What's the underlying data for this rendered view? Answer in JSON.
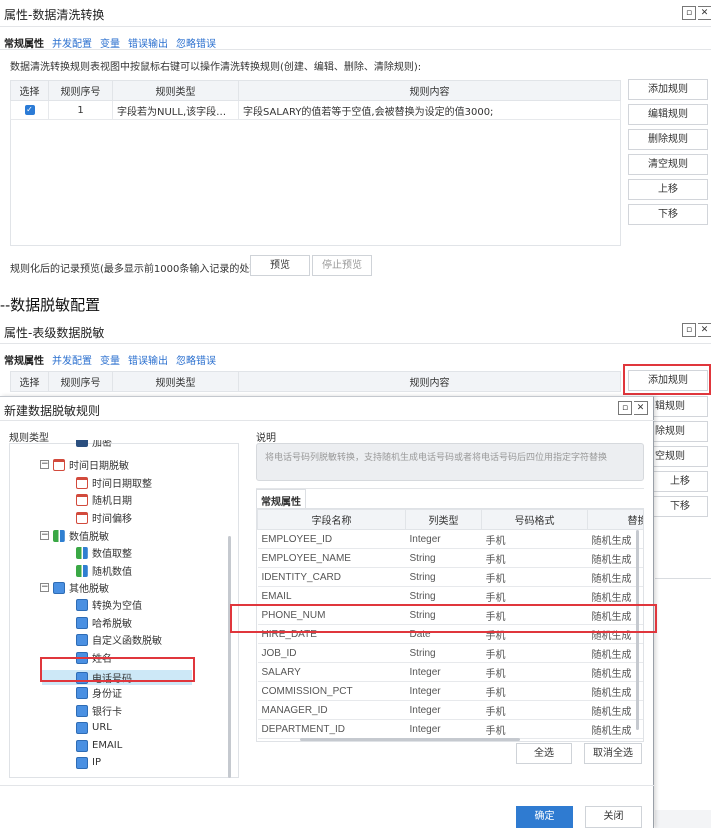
{
  "panel1": {
    "title": "属性-数据清洗转换",
    "tabs": [
      "常规属性",
      "并发配置",
      "变量",
      "错误输出",
      "忽略错误"
    ],
    "hint": "数据清洗转换规则表视图中按鼠标右键可以操作清洗转换规则(创建、编辑、删除、清除规则):",
    "table_headers": [
      "选择",
      "规则序号",
      "规则类型",
      "规则内容"
    ],
    "rows": [
      {
        "checked": true,
        "index": "1",
        "type": "字段若为NULL,该字段被...",
        "content": "字段SALARY的值若等于空值,会被替换为设定的值3000;"
      }
    ],
    "side_buttons": [
      "添加规则",
      "编辑规则",
      "删除规则",
      "清空规则",
      "上移",
      "下移"
    ],
    "preview_label": "规则化后的记录预览(最多显示前1000条输入记录的处理结果):",
    "preview_btn": "预览",
    "stop_preview_btn": "停止预览"
  },
  "caption": "--数据脱敏配置",
  "panel2": {
    "title": "属性-表级数据脱敏",
    "tabs": [
      "常规属性",
      "并发配置",
      "变量",
      "错误输出",
      "忽略错误"
    ],
    "table_headers": [
      "选择",
      "规则序号",
      "规则类型",
      "规则内容"
    ],
    "side_buttons": [
      "添加规则",
      "辑规则",
      "除规则",
      "空规则",
      "上移",
      "下移"
    ]
  },
  "dialog": {
    "title": "新建数据脱敏规则",
    "left_label": "规则类型",
    "desc_label": "说明",
    "desc_text": "将电话号码列脱敏转换，支持随机生成电话号码或者将电话号码后四位用指定字符替换",
    "tab": "常规属性",
    "tree": [
      {
        "level": 2,
        "icon": "misc",
        "label": "加密"
      },
      {
        "level": 1,
        "icon": "cal",
        "label": "时间日期脱敏",
        "toggle": "−"
      },
      {
        "level": 2,
        "icon": "cal",
        "label": "时间日期取整"
      },
      {
        "level": 2,
        "icon": "cal",
        "label": "随机日期"
      },
      {
        "level": 2,
        "icon": "cal",
        "label": "时间偏移"
      },
      {
        "level": 1,
        "icon": "num",
        "label": "数值脱敏",
        "toggle": "−"
      },
      {
        "level": 2,
        "icon": "num",
        "label": "数值取整"
      },
      {
        "level": 2,
        "icon": "num",
        "label": "随机数值"
      },
      {
        "level": 1,
        "icon": "oth",
        "label": "其他脱敏",
        "toggle": "−"
      },
      {
        "level": 2,
        "icon": "oth",
        "label": "转换为空值"
      },
      {
        "level": 2,
        "icon": "oth",
        "label": "哈希脱敏"
      },
      {
        "level": 2,
        "icon": "oth",
        "label": "自定义函数脱敏"
      },
      {
        "level": 2,
        "icon": "oth",
        "label": "姓名"
      },
      {
        "level": 2,
        "icon": "oth",
        "label": "电话号码",
        "selected": true
      },
      {
        "level": 2,
        "icon": "oth",
        "label": "身份证"
      },
      {
        "level": 2,
        "icon": "oth",
        "label": "银行卡"
      },
      {
        "level": 2,
        "icon": "oth",
        "label": "URL"
      },
      {
        "level": 2,
        "icon": "oth",
        "label": "EMAIL"
      },
      {
        "level": 2,
        "icon": "oth",
        "label": "IP"
      }
    ],
    "field_headers": [
      "字段名称",
      "列类型",
      "号码格式",
      "替换方"
    ],
    "fields": [
      [
        "EMPLOYEE_ID",
        "Integer",
        "手机",
        "随机生成"
      ],
      [
        "EMPLOYEE_NAME",
        "String",
        "手机",
        "随机生成"
      ],
      [
        "IDENTITY_CARD",
        "String",
        "手机",
        "随机生成"
      ],
      [
        "EMAIL",
        "String",
        "手机",
        "随机生成"
      ],
      [
        "PHONE_NUM",
        "String",
        "手机",
        "随机生成"
      ],
      [
        "HIRE_DATE",
        "Date",
        "手机",
        "随机生成"
      ],
      [
        "JOB_ID",
        "String",
        "手机",
        "随机生成"
      ],
      [
        "SALARY",
        "Integer",
        "手机",
        "随机生成"
      ],
      [
        "COMMISSION_PCT",
        "Integer",
        "手机",
        "随机生成"
      ],
      [
        "MANAGER_ID",
        "Integer",
        "手机",
        "随机生成"
      ],
      [
        "DEPARTMENT_ID",
        "Integer",
        "手机",
        "随机生成"
      ]
    ],
    "select_all": "全选",
    "deselect_all": "取消全选",
    "ok": "确定",
    "close": "关闭"
  }
}
